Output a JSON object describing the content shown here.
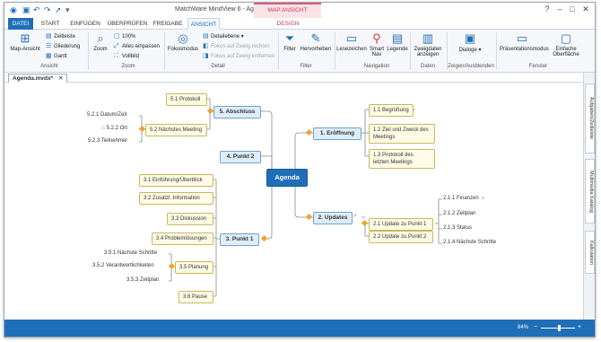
{
  "window": {
    "title": "MatchWare MindView 6 - Agenda.mvdx",
    "context_tab": "MAP ANSICHT"
  },
  "tabs": [
    {
      "label": "DATEI"
    },
    {
      "label": "START"
    },
    {
      "label": "EINFÜGEN"
    },
    {
      "label": "ÜBERPRÜFEN"
    },
    {
      "label": "FREIGABE"
    },
    {
      "label": "ANSICHT"
    },
    {
      "label": "DESIGN"
    }
  ],
  "ribbon": {
    "map_ansicht": "Map-Ansicht",
    "zeitleiste": "Zeitleiste",
    "gliederung": "Gliederung",
    "gantt": "Gantt",
    "group_ansicht": "Ansicht",
    "zoom": "Zoom",
    "zoom_100": "100%",
    "alles_einpassen": "Alles einpassen",
    "vollbild": "Vollbild",
    "group_zoom": "Zoom",
    "fokusmodus": "Fokusmodus",
    "detailebene": "Detailebene",
    "fokus_rechts": "Fokus auf Zweig rechten",
    "fokus_entfernen": "Fokus auf Zweig entfernen",
    "group_detail": "Detail",
    "filter": "Filter",
    "hervorheben": "Hervorheben",
    "group_filter": "Filter",
    "lesezeichen": "Lesezeichen",
    "smart_nav": "Smart Nav",
    "legende": "Legende",
    "group_navigation": "Navigation",
    "zweigdaten": "Zweigdaten anzeigen",
    "group_daten": "Daten",
    "dialoge": "Dialoge",
    "group_zeigen": "Zeigen/Ausblenden",
    "praesentationsmodus": "Präsentationsmodus",
    "einfache_oberflaeche": "Einfache Oberfläche",
    "group_fenster": "Fenster"
  },
  "document_tab": "Agenda.mvdx*",
  "map": {
    "center": "Agenda",
    "b1": "1. Eröffnung",
    "b1_1": "1.1 Begrüßung",
    "b1_2": "1.2 Ziel und Zweck des Meetings",
    "b1_3": "1.3 Protokoll des letzten Meetings",
    "b2": "2. Updates",
    "b2_1": "2.1 Update zu Punkt 1",
    "b2_1_1": "2.1.1 Finanzen",
    "b2_1_2": "2.1.2 Zeitplan",
    "b2_1_3": "2.1.3 Status",
    "b2_1_4": "2.1.4 Nächste Schritte",
    "b2_2": "2.2 Update zu Punkt 2",
    "b3": "3. Punkt 1",
    "b3_1": "3.1 Einführung/Überblick",
    "b3_2": "3.2 Zusätzl. Information",
    "b3_3": "3.3 Diskussion",
    "b3_4": "3.4 Problemlösungen",
    "b3_5": "3.5 Planung",
    "b3_5_1": "3.5.1 Nächste Schritte",
    "b3_5_2": "3.5.2 Verantwortlichkeiten",
    "b3_5_3": "3.5.3 Zeitplan",
    "b3_6": "3.6 Pause",
    "b4": "4. Punkt 2",
    "b5": "5. Abschluss",
    "b5_1": "5.1 Protokoll",
    "b5_2": "5.2 Nächstes Meeting",
    "b5_2_1": "5.2.1 Datum/Zeit",
    "b5_2_2": "5.2.2 Ort",
    "b5_2_3": "5.2.3 Teilnehmer"
  },
  "side_panel": {
    "tab1": "Aufgaben/Zeitleiste",
    "tab2": "Multimedia Katalog",
    "tab3": "Kalkulation"
  },
  "status": {
    "zoom": "84%",
    "minus": "−",
    "plus": "+"
  },
  "colors": {
    "accent": "#1f6fb8",
    "topic_fill": "#fffbe5",
    "main_fill": "#deeef9",
    "connector": "#e0a030"
  }
}
